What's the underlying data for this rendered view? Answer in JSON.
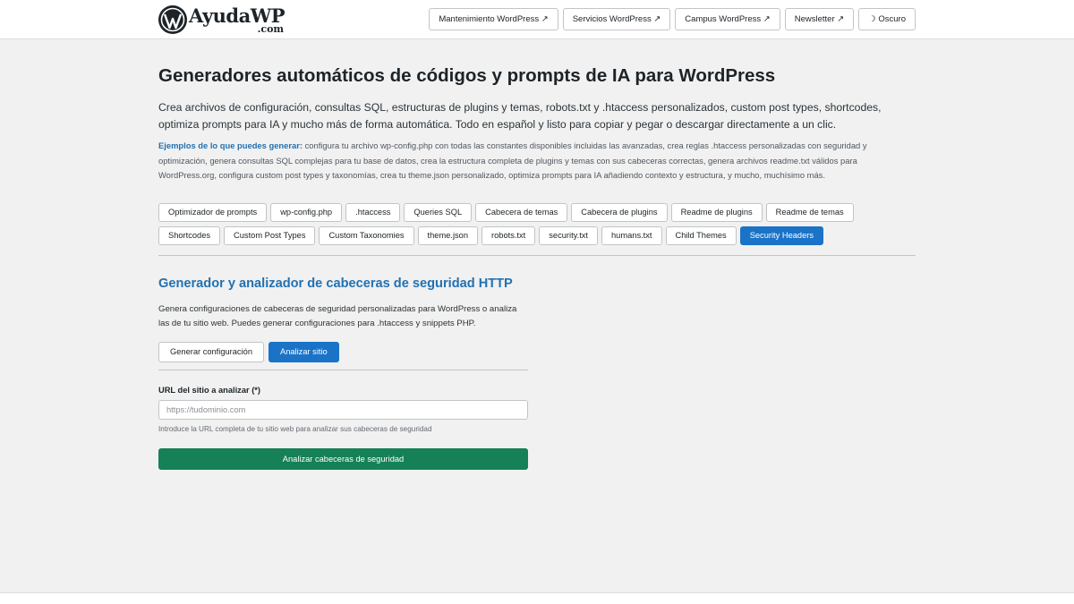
{
  "header": {
    "logo": {
      "name": "AyudaWP",
      "domain": ".com",
      "icon": "wordpress-logo-icon"
    },
    "nav": [
      {
        "label": "Mantenimiento WordPress ↗",
        "name": "nav-mantenimiento"
      },
      {
        "label": "Servicios WordPress ↗",
        "name": "nav-servicios"
      },
      {
        "label": "Campus WordPress ↗",
        "name": "nav-campus"
      },
      {
        "label": "Newsletter ↗",
        "name": "nav-newsletter"
      },
      {
        "label": "☽ Oscuro",
        "name": "theme-toggle"
      }
    ]
  },
  "main": {
    "title": "Generadores automáticos de códigos y prompts de IA para WordPress",
    "intro": "Crea archivos de configuración, consultas SQL, estructuras de plugins y temas, robots.txt y .htaccess personalizados, custom post types, shortcodes, optimiza prompts para IA y mucho más de forma automática. Todo en español y listo para copiar y pegar o descargar directamente a un clic.",
    "examples": {
      "lead": "Ejemplos de lo que puedes generar:",
      "text": " configura tu archivo wp-config.php con todas las constantes disponibles incluidas las avanzadas, crea reglas .htaccess personalizadas con seguridad y optimización, genera consultas SQL complejas para tu base de datos, crea la estructura completa de plugins y temas con sus cabeceras correctas, genera archivos readme.txt válidos para WordPress.org, configura custom post types y taxonomías, crea tu theme.json personalizado, optimiza prompts para IA añadiendo contexto y estructura, y mucho, muchísimo más."
    },
    "tabs": [
      "Optimizador de prompts",
      "wp-config.php",
      ".htaccess",
      "Queries SQL",
      "Cabecera de temas",
      "Cabecera de plugins",
      "Readme de plugins",
      "Readme de temas",
      "Shortcodes",
      "Custom Post Types",
      "Custom Taxonomies",
      "theme.json",
      "robots.txt",
      "security.txt",
      "humans.txt",
      "Child Themes",
      "Security Headers"
    ],
    "active_tab": "Security Headers"
  },
  "tool": {
    "title": "Generador y analizador de cabeceras de seguridad HTTP",
    "description": "Genera configuraciones de cabeceras de seguridad personalizadas para WordPress o analiza las de tu sitio web. Puedes generar configuraciones para .htaccess y snippets PHP.",
    "modes": [
      {
        "label": "Generar configuración",
        "active": false
      },
      {
        "label": "Analizar sitio",
        "active": true
      }
    ],
    "url_field": {
      "label": "URL del sitio a analizar (*)",
      "placeholder": "https://tudominio.com",
      "value": "",
      "help": "Introduce la URL completa de tu sitio web para analizar sus cabeceras de seguridad"
    },
    "submit_label": "Analizar cabeceras de seguridad"
  },
  "colors": {
    "accent": "#1a73c7",
    "link": "#2271b1",
    "submit": "#168057",
    "background": "#f1f1f1"
  }
}
